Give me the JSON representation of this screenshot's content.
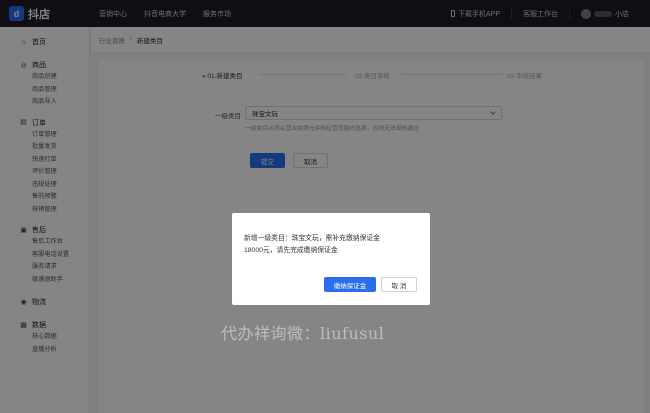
{
  "header": {
    "brand": "抖店",
    "nav": [
      "营销中心",
      "抖音电商大学",
      "服务市场"
    ],
    "download_app": "下载手机APP",
    "support": "客服工作台",
    "shop_suffix": "小店"
  },
  "sidebar": {
    "groups": [
      {
        "title": "首页",
        "icon": "home-icon",
        "items": []
      },
      {
        "title": "商品",
        "icon": "goods-icon",
        "items": [
          "商品创建",
          "商品管理",
          "商品导入"
        ]
      },
      {
        "title": "订单",
        "icon": "order-icon",
        "items": [
          "订单管理",
          "批量发货",
          "快速打单",
          "评价管理",
          "违规处理",
          "售前预警",
          "核销管理"
        ]
      },
      {
        "title": "售后",
        "icon": "aftersale-icon",
        "items": [
          "售后工作台",
          "客服电话设置",
          "服务请求",
          "极速退助手"
        ]
      },
      {
        "title": "物流",
        "icon": "logistics-icon",
        "items": []
      },
      {
        "title": "数据",
        "icon": "data-icon",
        "items": [
          "核心数据",
          "直播分析"
        ]
      }
    ]
  },
  "breadcrumb": {
    "parent": "行业资质",
    "separator": "/",
    "current": "新建类目"
  },
  "steps": [
    "» 01.新建类目",
    "02.类目审核",
    "03.审核结果"
  ],
  "form": {
    "label": "一级类目",
    "value": "珠宝文玩",
    "hint": "一级类目必须从营业执照允许的经营范围内选择，否则无法审核通过",
    "submit": "提交",
    "cancel": "取消"
  },
  "dialog": {
    "line1": "新增一级类目：珠宝文玩，需补充缴纳保证金",
    "line2": "18000元，请先完成缴纳保证金",
    "confirm": "缴纳保证金",
    "cancel": "取 消"
  },
  "watermark": "代办祥询微：liufusul",
  "colors": {
    "topbar": "#1b1c26",
    "primary": "#2a6ef0"
  }
}
